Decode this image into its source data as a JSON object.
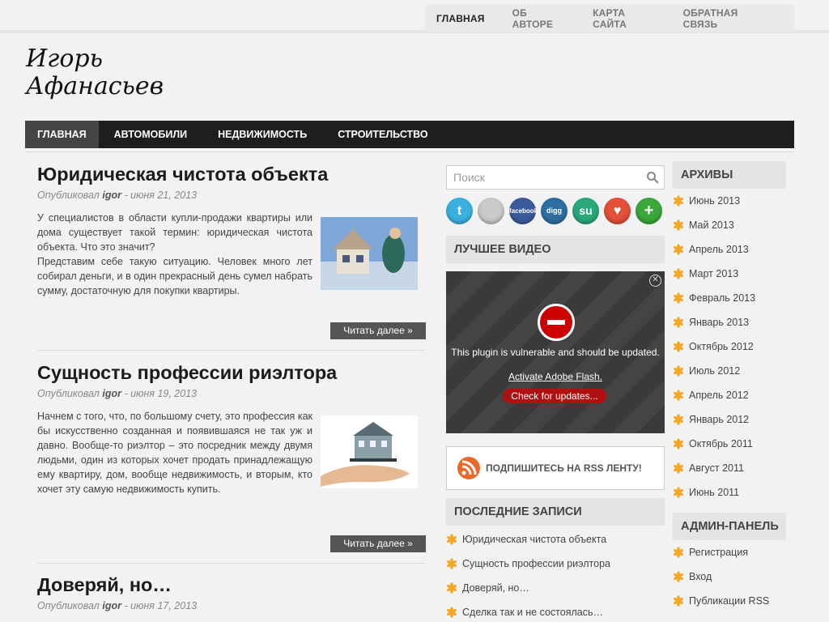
{
  "topnav": [
    "ГЛАВНАЯ",
    "ОБ АВТОРЕ",
    "КАРТА САЙТА",
    "ОБРАТНАЯ СВЯЗЬ"
  ],
  "logo": {
    "line1": "Игорь",
    "line2": "Афанасьев"
  },
  "mainnav": [
    "ГЛАВНАЯ",
    "АВТОМОБИЛИ",
    "НЕДВИЖИМОСТЬ",
    "СТРОИТЕЛЬСТВО"
  ],
  "posts": [
    {
      "title": "Юридическая чистота объекта",
      "meta_prefix": "Опубликовал",
      "author": "igor",
      "date": "- июня 21, 2013",
      "excerpt": "У специалистов в области купли-продажи квартиры или дома существует такой термин: юридическая чистота объекта. Что это значит?\nПредставим себе такую ситуацию. Человек много лет собирал деньги, и в один прекрасный день сумел набрать сумму, достаточную для покупки квартиры.",
      "readmore": "Читать далее »"
    },
    {
      "title": "Сущность профессии риэлтора",
      "meta_prefix": "Опубликовал",
      "author": "igor",
      "date": "- июня 19, 2013",
      "excerpt": "Начнем с того, что, по большому счету, это профессия как бы искусственно созданная и появившаяся не так уж и давно. Вообще-то риэлтор – это посредник между двумя людьми, один из которых хочет продать принадлежащую ему квартиру, дом, вообще недвижимость, и вторым, кто хочет эту самую недвижимость купить.",
      "readmore": "Читать далее »"
    },
    {
      "title": "Доверяй, но…",
      "meta_prefix": "Опубликовал",
      "author": "igor",
      "date": "- июня 17, 2013"
    }
  ],
  "search_placeholder": "Поиск",
  "social": [
    "twitter",
    "delicious",
    "facebook",
    "digg",
    "stumbleupon",
    "favorite",
    "add"
  ],
  "social_labels": {
    "facebook": "facebook",
    "digg": "digg"
  },
  "widgets": {
    "video_title": "ЛУЧШЕЕ ВИДЕО",
    "video_msg": "This plugin is vulnerable and should be updated.",
    "video_activate": "Activate Adobe Flash.",
    "video_check": "Check for updates...",
    "rss": "ПОДПИШИТЕСЬ НА RSS ЛЕНТУ!",
    "recent_title": "ПОСЛЕДНИЕ ЗАПИСИ",
    "recent": [
      "Юридическая чистота объекта",
      "Сущность профессии риэлтора",
      "Доверяй, но…",
      "Сделка так и не состоялась…"
    ],
    "archives_title": "АРХИВЫ",
    "archives": [
      "Июнь 2013",
      "Май 2013",
      "Апрель 2013",
      "Март 2013",
      "Февраль 2013",
      "Январь 2013",
      "Октябрь 2012",
      "Июль 2012",
      "Апрель 2012",
      "Январь 2012",
      "Октябрь 2011",
      "Август 2011",
      "Июнь 2011"
    ],
    "admin_title": "АДМИН-ПАНЕЛЬ",
    "admin": [
      "Регистрация",
      "Вход",
      "Публикации RSS"
    ]
  },
  "colors": {
    "accent": "#f5a623",
    "nav_bg": "#1e1e1e",
    "nav_active": "#444444",
    "button": "#555555"
  }
}
